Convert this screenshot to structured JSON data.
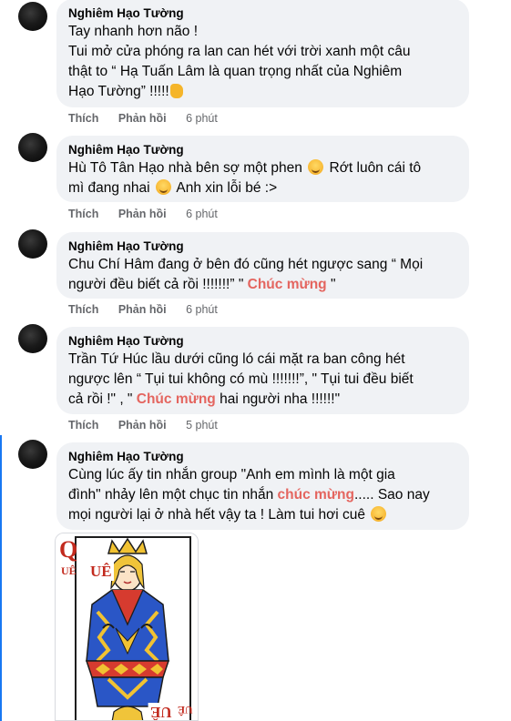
{
  "comments": [
    {
      "author": "Nghiêm Hạo Tường",
      "lines": [
        "Tay nhanh hơn não !",
        "Tui mở cửa phóng ra lan can hét với trời xanh một câu",
        "thật to “ Hạ Tuấn Lâm là quan trọng nhất của Nghiêm",
        "Hạo Tường” !!!!!"
      ],
      "like": "Thích",
      "reply": "Phản hồi",
      "time": "6 phút"
    },
    {
      "author": "Nghiêm Hạo Tường",
      "lines": [
        "Hù Tô Tân Hạo nhà bên sợ một phen",
        "Rớt luôn cái tô",
        "mì đang nhai",
        "Anh xin lỗi bé :>"
      ],
      "like": "Thích",
      "reply": "Phản hồi",
      "time": "6 phút"
    },
    {
      "author": "Nghiêm Hạo Tường",
      "lines": [
        "Chu Chí Hâm đang ở bên đó cũng hét ngược sang “ Mọi",
        "người đều biết cả rồi !!!!!!!” \"",
        "Chúc mừng",
        " \""
      ],
      "like": "Thích",
      "reply": "Phản hồi",
      "time": "6 phút"
    },
    {
      "author": "Nghiêm Hạo Tường",
      "lines": [
        "Trần Tứ Húc lầu dưới cũng ló cái mặt ra ban công hét",
        "ngược lên “ Tụi tui không có mù !!!!!!!”, \" Tụi tui đều biết",
        "cả rồi !\" , \"",
        "Chúc mừng",
        " hai người nha !!!!!!\""
      ],
      "like": "Thích",
      "reply": "Phản hồi",
      "time": "5 phút"
    },
    {
      "author": "Nghiêm Hạo Tường",
      "lines": [
        "Cùng lúc ấy tin nhắn group \"Anh em mình là một gia",
        "đình\" nhảy lên một chục tin nhắn ",
        "chúc mừng",
        "..... Sao nay",
        "mọi người lại ở nhà hết vậy ta ! Làm tui hơi cuê"
      ]
    }
  ],
  "card": {
    "rank": "Q",
    "small_text": "UÊ",
    "center_text": "UÊ",
    "bottom_text": "UÊ"
  },
  "colors": {
    "bubble": "#f0f2f5",
    "highlight": "#e4655f",
    "meta": "#65676b",
    "thread_line": "#1877f2"
  },
  "icons": [
    "avatar",
    "smile-emoji",
    "hand-emoji"
  ]
}
